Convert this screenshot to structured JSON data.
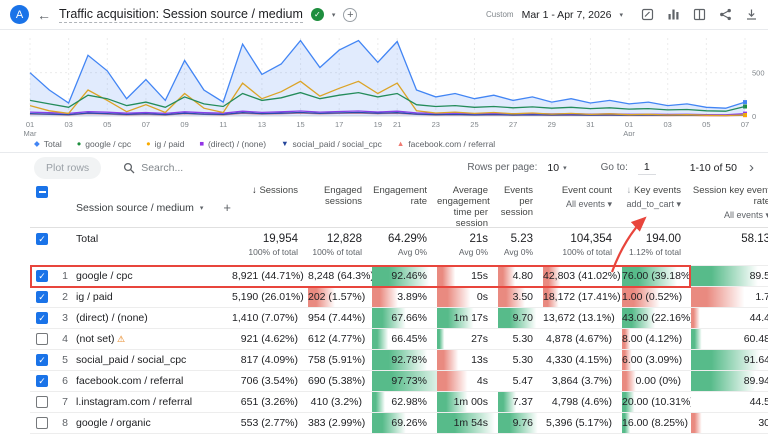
{
  "colors": {
    "accent": "#1a73e8",
    "annotation": "#e8453c",
    "heat_green": "#57bb8a",
    "heat_red": "#e98a80"
  },
  "header": {
    "avatar_letter": "A",
    "title": "Traffic acquisition: Session source / medium",
    "date_type": "Custom",
    "date_range": "Mar 1 - Apr 7, 2026"
  },
  "chart": {
    "type": "line",
    "y_max": 900,
    "y_axis": [
      {
        "v": 500,
        "label": "500"
      },
      {
        "v": 0,
        "label": "0"
      }
    ],
    "x_ticks": [
      "01|Mar",
      "03",
      "05",
      "07",
      "09",
      "11",
      "13",
      "15",
      "17",
      "19",
      "21",
      "23",
      "25",
      "27",
      "29",
      "31",
      "01|Apr",
      "03",
      "05",
      "07"
    ],
    "series": [
      {
        "name": "Total",
        "color": "#4285f4",
        "marker": "◆",
        "area": true,
        "values": [
          500,
          300,
          150,
          700,
          520,
          200,
          420,
          180,
          640,
          300,
          160,
          830,
          480,
          600,
          870,
          560,
          760,
          870,
          620,
          860,
          300,
          220,
          260,
          200,
          240,
          180,
          220,
          160,
          200,
          150,
          180,
          140,
          160,
          120,
          140,
          100,
          90,
          160
        ]
      },
      {
        "name": "google / cpc",
        "color": "#1e8e3e",
        "marker": "●",
        "values": [
          180,
          140,
          100,
          240,
          200,
          120,
          160,
          100,
          220,
          140,
          110,
          260,
          180,
          210,
          270,
          200,
          240,
          270,
          220,
          260,
          130,
          110,
          120,
          100,
          110,
          95,
          105,
          90,
          100,
          85,
          95,
          80,
          85,
          70,
          75,
          60,
          55,
          110
        ]
      },
      {
        "name": "ig / paid",
        "color": "#f9ab00",
        "marker": "●",
        "values": [
          120,
          60,
          30,
          300,
          180,
          50,
          130,
          40,
          260,
          90,
          40,
          380,
          200,
          280,
          400,
          230,
          320,
          400,
          260,
          380,
          60,
          35,
          45,
          30,
          40,
          25,
          35,
          22,
          30,
          18,
          25,
          15,
          20,
          12,
          15,
          8,
          6,
          12
        ]
      },
      {
        "name": "(direct) / (none)",
        "color": "#9334e6",
        "marker": "■",
        "values": [
          45,
          38,
          30,
          50,
          44,
          32,
          40,
          30,
          48,
          38,
          32,
          55,
          42,
          48,
          58,
          45,
          52,
          58,
          46,
          55,
          36,
          30,
          33,
          28,
          31,
          26,
          29,
          24,
          27,
          22,
          25,
          20,
          22,
          18,
          20,
          15,
          14,
          28
        ]
      },
      {
        "name": "social_paid / social_cpc",
        "color": "#24459a",
        "marker": "▼",
        "values": [
          28,
          22,
          16,
          34,
          28,
          18,
          26,
          16,
          32,
          22,
          18,
          38,
          28,
          32,
          40,
          30,
          36,
          40,
          32,
          38,
          22,
          16,
          19,
          14,
          17,
          12,
          15,
          11,
          13,
          10,
          12,
          9,
          10,
          8,
          9,
          7,
          6,
          11
        ]
      },
      {
        "name": "facebook.com / referral",
        "color": "#f07b72",
        "marker": "▲",
        "values": [
          22,
          18,
          12,
          28,
          22,
          14,
          20,
          12,
          26,
          18,
          14,
          30,
          22,
          26,
          34,
          24,
          30,
          34,
          26,
          30,
          18,
          12,
          15,
          10,
          13,
          9,
          12,
          8,
          10,
          7,
          9,
          6,
          8,
          5,
          7,
          4,
          4,
          9
        ]
      }
    ]
  },
  "toolbar": {
    "plot_rows": "Plot rows",
    "search_placeholder": "Search...",
    "rows_per_page_label": "Rows per page:",
    "rows_per_page_value": "10",
    "goto_label": "Go to:",
    "goto_value": "1",
    "pagination": "1-10 of 50"
  },
  "table": {
    "dimension": "Session source / medium",
    "columns": [
      {
        "label": "Sessions",
        "sort": "active"
      },
      {
        "label": "Engaged sessions"
      },
      {
        "label": "Engagement rate"
      },
      {
        "label": "Average engagement time per session"
      },
      {
        "label": "Events per session"
      },
      {
        "label": "Event count",
        "sub": "All events"
      },
      {
        "label": "Key events",
        "sub": "add_to_cart",
        "sort": "hover"
      },
      {
        "label": "Session key event rate",
        "sub": "All events"
      }
    ],
    "totals": {
      "label": "Total",
      "cells": [
        {
          "v": "19,954",
          "s": "100% of total"
        },
        {
          "v": "12,828",
          "s": "100% of total"
        },
        {
          "v": "64.29%",
          "s": "Avg 0%"
        },
        {
          "v": "21s",
          "s": "Avg 0%"
        },
        {
          "v": "5.23",
          "s": "Avg 0%"
        },
        {
          "v": "104,354",
          "s": "100% of total"
        },
        {
          "v": "194.00",
          "s": "1.12% of total"
        },
        {
          "v": "58.13",
          "s": ""
        }
      ]
    },
    "rows": [
      {
        "num": "1",
        "checked": true,
        "highlight": true,
        "source": "google / cpc",
        "warn": false,
        "cells": [
          {
            "v": "8,921 (44.71%)"
          },
          {
            "v": "8,248 (64.3%)"
          },
          {
            "v": "92.46%",
            "h": "g88"
          },
          {
            "v": "15s",
            "h": "r30"
          },
          {
            "v": "4.80",
            "h": "r38"
          },
          {
            "v": "42,803 (41.02%)",
            "h": "r22"
          },
          {
            "v": "76.00 (39.18%)",
            "h": "g80"
          },
          {
            "v": "89.5",
            "h": "g75"
          }
        ]
      },
      {
        "num": "2",
        "checked": true,
        "highlight": false,
        "source": "ig / paid",
        "warn": false,
        "cells": [
          {
            "v": "5,190 (26.01%)"
          },
          {
            "v": "202 (1.57%)",
            "h": "r42"
          },
          {
            "v": "3.89%",
            "h": "r40"
          },
          {
            "v": "0s",
            "h": "r55"
          },
          {
            "v": "3.50",
            "h": "r60"
          },
          {
            "v": "18,172 (17.41%)",
            "h": "r20"
          },
          {
            "v": "1.00 (0.52%)",
            "h": "r55"
          },
          {
            "v": "1.7",
            "h": "r60"
          }
        ]
      },
      {
        "num": "3",
        "checked": true,
        "highlight": false,
        "source": "(direct) / (none)",
        "warn": false,
        "cells": [
          {
            "v": "1,410 (7.07%)"
          },
          {
            "v": "954 (7.44%)"
          },
          {
            "v": "67.66%",
            "h": "g52"
          },
          {
            "v": "1m 17s",
            "h": "g60"
          },
          {
            "v": "9.70",
            "h": "g85"
          },
          {
            "v": "13,672 (13.1%)"
          },
          {
            "v": "43.00 (22.16%)",
            "h": "g48"
          },
          {
            "v": "44.4",
            "h": "r10"
          }
        ]
      },
      {
        "num": "4",
        "checked": false,
        "highlight": false,
        "source": "(not set)",
        "warn": true,
        "cells": [
          {
            "v": "921 (4.62%)"
          },
          {
            "v": "612 (4.77%)"
          },
          {
            "v": "66.45%",
            "h": "g25"
          },
          {
            "v": "27s",
            "h": "g12"
          },
          {
            "v": "5.30"
          },
          {
            "v": "4,878 (4.67%)"
          },
          {
            "v": "8.00 (4.12%)",
            "h": "r12"
          },
          {
            "v": "60.48",
            "h": "g12"
          }
        ]
      },
      {
        "num": "5",
        "checked": true,
        "highlight": false,
        "source": "social_paid / social_cpc",
        "warn": false,
        "cells": [
          {
            "v": "817 (4.09%)"
          },
          {
            "v": "758 (5.91%)"
          },
          {
            "v": "92.78%",
            "h": "g85"
          },
          {
            "v": "13s",
            "h": "r35"
          },
          {
            "v": "5.30"
          },
          {
            "v": "4,330 (4.15%)"
          },
          {
            "v": "6.00 (3.09%)",
            "h": "r14"
          },
          {
            "v": "91.64",
            "h": "g78"
          }
        ]
      },
      {
        "num": "6",
        "checked": true,
        "highlight": false,
        "source": "facebook.com / referral",
        "warn": false,
        "cells": [
          {
            "v": "706 (3.54%)"
          },
          {
            "v": "690 (5.38%)"
          },
          {
            "v": "97.73%",
            "h": "g100"
          },
          {
            "v": "4s",
            "h": "r50"
          },
          {
            "v": "5.47"
          },
          {
            "v": "3,864 (3.7%)"
          },
          {
            "v": "0.00 (0%)",
            "h": "r20"
          },
          {
            "v": "89.94",
            "h": "g72"
          }
        ]
      },
      {
        "num": "7",
        "checked": false,
        "highlight": false,
        "source": "l.instagram.com / referral",
        "warn": false,
        "cells": [
          {
            "v": "651 (3.26%)"
          },
          {
            "v": "410 (3.2%)"
          },
          {
            "v": "62.98%",
            "h": "g20"
          },
          {
            "v": "1m 00s",
            "h": "g50"
          },
          {
            "v": "7.37",
            "h": "g40"
          },
          {
            "v": "4,798 (4.6%)"
          },
          {
            "v": "20.00 (10.31%)",
            "h": "g18"
          },
          {
            "v": "44.5"
          }
        ]
      },
      {
        "num": "8",
        "checked": false,
        "highlight": false,
        "source": "google / organic",
        "warn": false,
        "cells": [
          {
            "v": "553 (2.77%)"
          },
          {
            "v": "383 (2.99%)"
          },
          {
            "v": "69.26%",
            "h": "g52"
          },
          {
            "v": "1m 54s",
            "h": "g95"
          },
          {
            "v": "9.76",
            "h": "g88"
          },
          {
            "v": "5,396 (5.17%)"
          },
          {
            "v": "16.00 (8.25%)",
            "h": "g12"
          },
          {
            "v": "30",
            "h": "r12"
          }
        ]
      }
    ]
  },
  "annotations": {
    "highlighted_row": "google / cpc",
    "arrow_target": "add_to_cart"
  }
}
